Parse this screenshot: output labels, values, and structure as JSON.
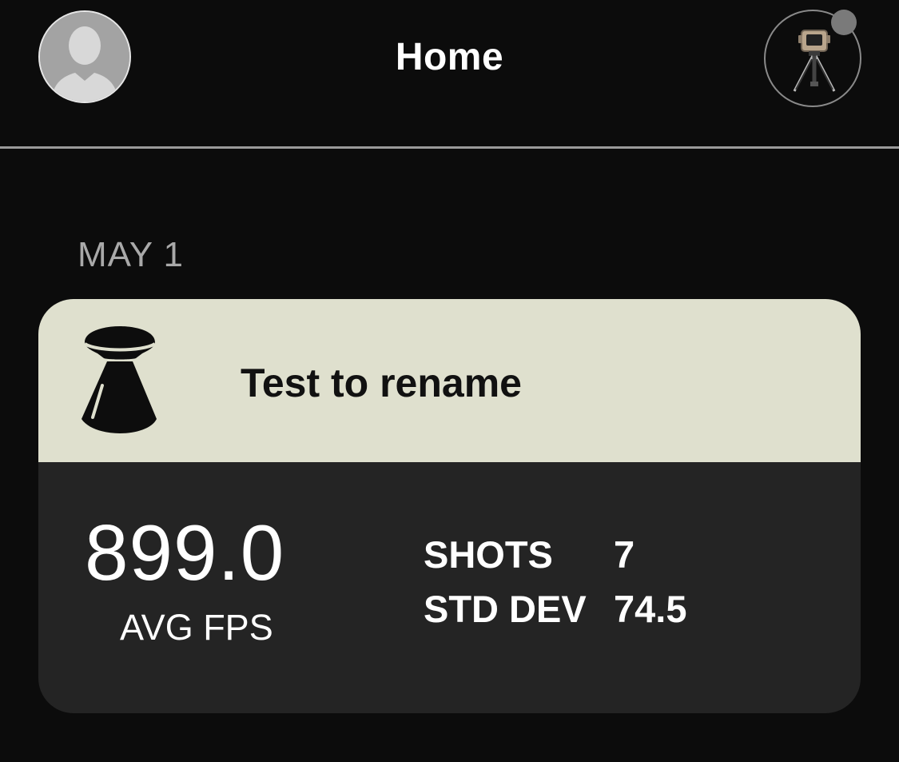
{
  "header": {
    "title": "Home",
    "profile_icon": "user-avatar-icon",
    "device_icon": "chronograph-tripod-icon"
  },
  "section": {
    "date": "MAY 1"
  },
  "session": {
    "title": "Test to rename",
    "icon": "pellet-icon",
    "avg_value": "899.0",
    "avg_label": "AVG FPS",
    "stats": [
      {
        "label": "SHOTS",
        "value": "7"
      },
      {
        "label": "STD DEV",
        "value": "74.5"
      }
    ]
  },
  "colors": {
    "background": "#0c0c0c",
    "card_header": "#dfe0ce",
    "card_body": "#242424",
    "status_dot": "#7a7a7a",
    "date_text": "#a9a9a9"
  }
}
